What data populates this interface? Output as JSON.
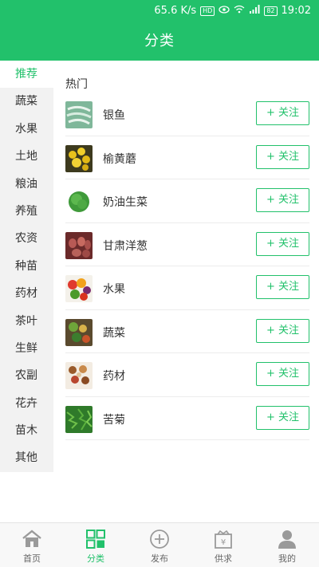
{
  "status_bar": {
    "speed": "65.6 K/s",
    "hd": "HD",
    "battery": "82",
    "time": "19:02"
  },
  "header": {
    "title": "分类"
  },
  "sidebar": {
    "items": [
      {
        "label": "推荐",
        "active": true
      },
      {
        "label": "蔬菜"
      },
      {
        "label": "水果"
      },
      {
        "label": "土地"
      },
      {
        "label": "粮油"
      },
      {
        "label": "养殖"
      },
      {
        "label": "农资"
      },
      {
        "label": "种苗"
      },
      {
        "label": "药材"
      },
      {
        "label": "茶叶"
      },
      {
        "label": "生鲜"
      },
      {
        "label": "农副"
      },
      {
        "label": "花卉"
      },
      {
        "label": "苗木"
      },
      {
        "label": "其他"
      }
    ]
  },
  "main": {
    "section_title": "热门",
    "follow_label": "+ 关注",
    "items": [
      {
        "name": "银鱼",
        "thumb": "silverfish-photo"
      },
      {
        "name": "榆黄蘑",
        "thumb": "golden-mushroom-photo"
      },
      {
        "name": "奶油生菜",
        "thumb": "butter-lettuce-photo"
      },
      {
        "name": "甘肃洋葱",
        "thumb": "onion-photo"
      },
      {
        "name": "水果",
        "thumb": "fruit-photo"
      },
      {
        "name": "蔬菜",
        "thumb": "vegetable-photo"
      },
      {
        "name": "药材",
        "thumb": "herb-photo"
      },
      {
        "name": "苦菊",
        "thumb": "endive-photo"
      }
    ]
  },
  "tabbar": {
    "tabs": [
      {
        "label": "首页",
        "icon": "home-icon"
      },
      {
        "label": "分类",
        "icon": "category-icon",
        "active": true
      },
      {
        "label": "发布",
        "icon": "publish-icon"
      },
      {
        "label": "供求",
        "icon": "supply-demand-icon"
      },
      {
        "label": "我的",
        "icon": "profile-icon"
      }
    ]
  },
  "colors": {
    "accent": "#22c16b",
    "sidebar_bg": "#f2f2f2"
  }
}
